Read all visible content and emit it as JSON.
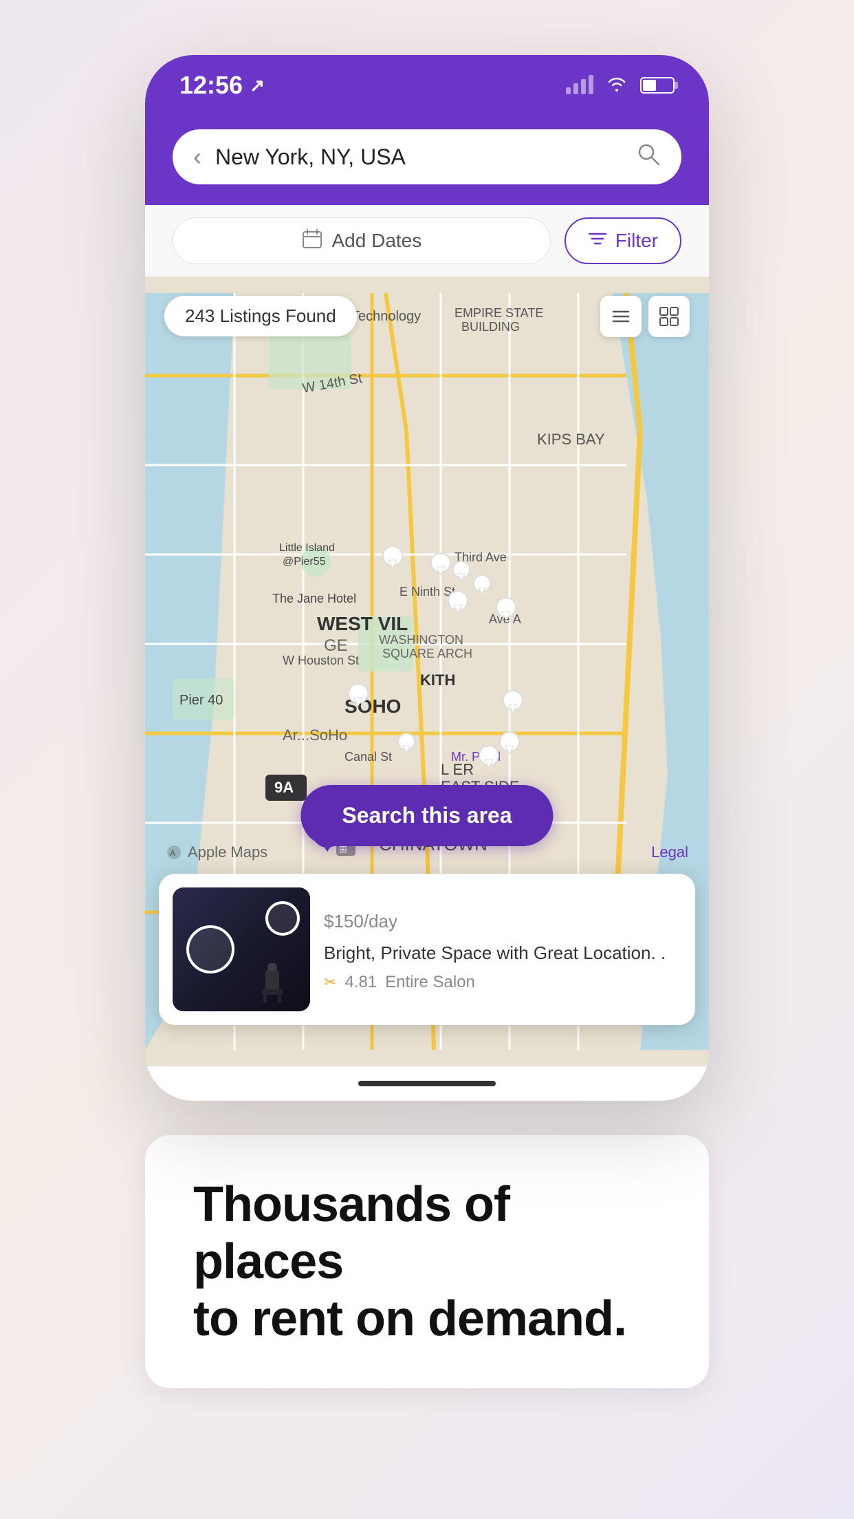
{
  "statusBar": {
    "time": "12:56",
    "locationArrow": "↗"
  },
  "searchBar": {
    "placeholder": "New York, NY, USA",
    "value": "New York, NY, USA"
  },
  "filters": {
    "addDatesLabel": "Add Dates",
    "filterLabel": "Filter"
  },
  "map": {
    "listingsCount": "243 Listings Found",
    "searchAreaButton": "Search this area",
    "appleMaps": "Apple Maps",
    "legal": "Legal"
  },
  "listing": {
    "price": "$150",
    "priceUnit": "/day",
    "name": "Bright, Private Space with Great Location. .",
    "rating": "4.81",
    "type": "Entire Salon"
  },
  "tagline": {
    "line1": "Thousands of places",
    "line2": "to rent on demand."
  },
  "icons": {
    "back": "‹",
    "search": "⌕",
    "calendar": "⊞",
    "filter": "≡",
    "listView": "☰",
    "mapView": "⊞",
    "personIcon": "✂"
  }
}
